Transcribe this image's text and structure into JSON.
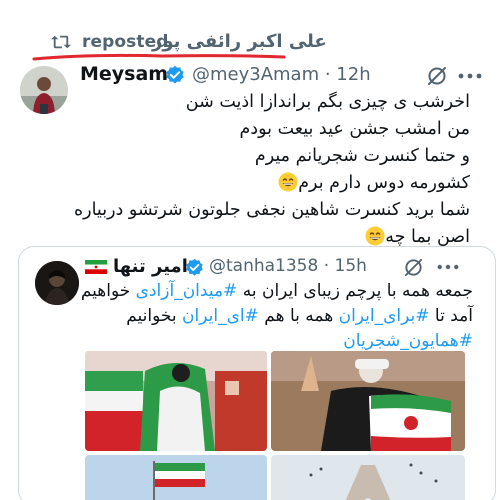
{
  "repost": {
    "name": "علی اکبر رائفی پور",
    "label": "reposted",
    "icon": "repost-icon"
  },
  "tweet": {
    "author": {
      "display_name": "Meysam",
      "handle": "@mey3Amam",
      "time": "12h",
      "verified": true,
      "avatar": "person-photo"
    },
    "lines": [
      "اخرشب ی چیزی بگم براندازا اذیت شن",
      "من امشب جشن عید بیعت بودم",
      "و حتما کنسرت شجریانم میرم",
      "کشورمه دوس دارم برم",
      "شما برید کنسرت شاهین نجفی جلوتون شرتشو دربیاره",
      "اصن بما چه"
    ],
    "emoji": "grinning-face-emoji"
  },
  "quote": {
    "author": {
      "display_name": "امیر تنها",
      "handle": "@tanha1358",
      "time": "15h",
      "verified": true,
      "flag": "iran-flag-icon"
    },
    "line1_text": "جمعه همه با پرچم زیبای ایران به ",
    "line1_tag": "#میدان_آزادی",
    "line1_end": " خواهیم",
    "line2_text_a": "آمد تا ",
    "line2_tag_a": "#برای_ایران",
    "line2_text_b": " همه با هم ",
    "line2_tag_b": "#ای_ایران",
    "line2_end": " بخوانیم",
    "line3_tag": "#همایون_شجریان",
    "media": [
      "stadium-flag-photo",
      "rally-flag-photo",
      "flag-sky-photo",
      "azadi-tower-photo"
    ]
  },
  "colors": {
    "accent": "#1d9bf0",
    "secondary_text": "#536471",
    "underline": "#e0282e",
    "verified": "#1d9bf0"
  }
}
